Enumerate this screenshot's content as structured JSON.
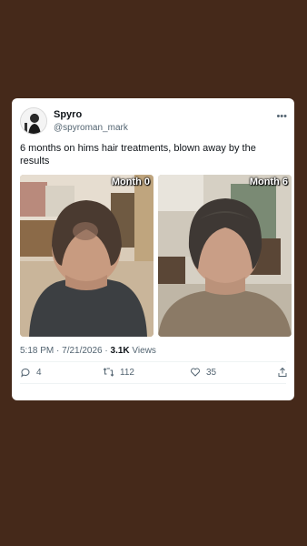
{
  "post": {
    "author_name": "Spyro",
    "author_handle": "@spyroman_mark",
    "more_icon": "more-horizontal-icon",
    "text": "6 months on hims hair treatments, blown away by the results",
    "images": [
      {
        "label": "Month 0"
      },
      {
        "label": "Month 6"
      }
    ],
    "timestamp": "5:18 PM · 7/21/2026 · ",
    "views_count": "3.1K",
    "views_label": " Views",
    "actions": {
      "reply_count": "4",
      "repost_count": "112",
      "like_count": "35"
    }
  },
  "colors": {
    "background": "#45291a",
    "card": "#ffffff",
    "secondary_text": "#536471",
    "primary_text": "#0f1419"
  }
}
